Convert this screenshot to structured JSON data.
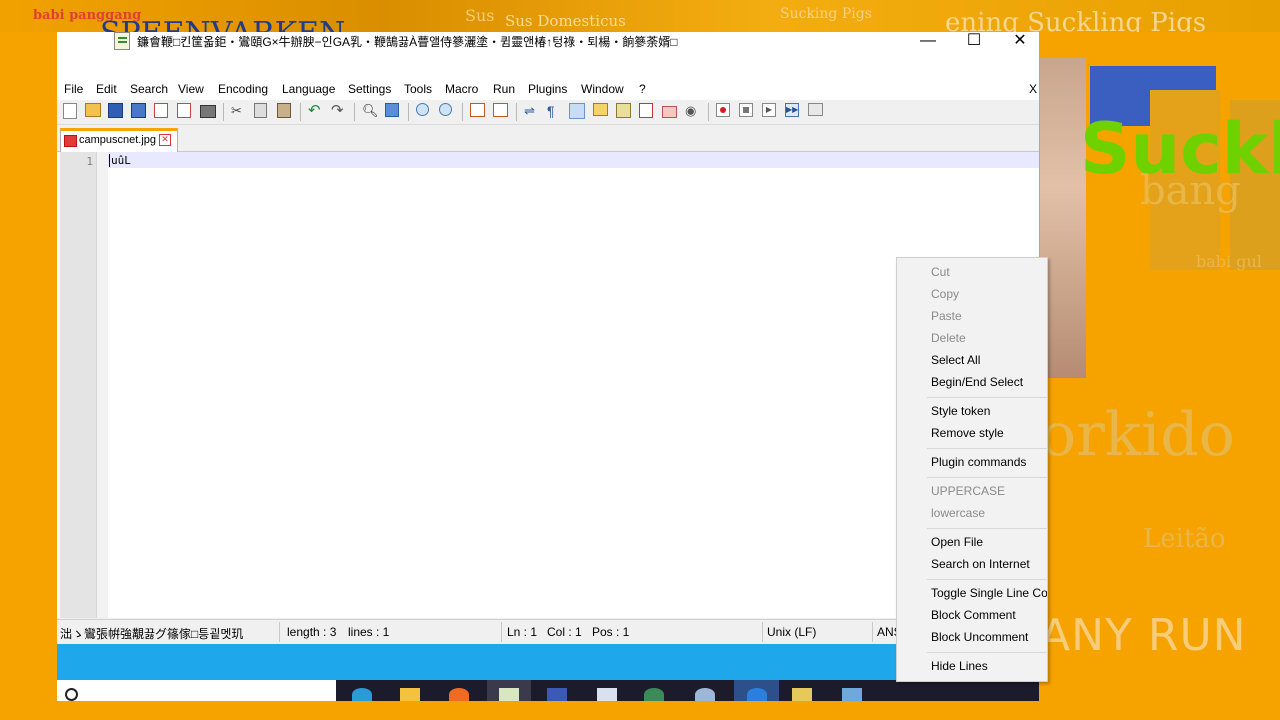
{
  "desktop": {
    "bg_texts": {
      "top_left": "babi panggang",
      "big_blue": "SPEENVARKEN",
      "sus": "Sus",
      "domesticus": "Sus Domesticus",
      "roasting": "Sucking Pigs",
      "top_right": "ening Suckling Pigs"
    },
    "words": {
      "suckl": "Suckl",
      "bang": "bang",
      "babi": "babi gul",
      "orkido": "orkido",
      "leitao": "Leitão"
    },
    "watermark": "ANY RUN"
  },
  "window": {
    "title": "鐮會鞭□킨筐옯鉅‧鸞頤G×牛辦腴−인GA乳‧鞭鵠끓À瞢앨侍篸灑塗‧큄靈앤椿↑텅祿‧퇴楊‧餉篸荼婿□",
    "controls": {
      "minimize": "—",
      "maximize": "☐",
      "close": "✕"
    },
    "menu": [
      "File",
      "Edit",
      "Search",
      "View",
      "Encoding",
      "Language",
      "Settings",
      "Tools",
      "Macro",
      "Run",
      "Plugins",
      "Window",
      "?"
    ],
    "menu_close": "X",
    "toolbar_icons": [
      "new-icon",
      "open-icon",
      "save-icon",
      "save-all-icon",
      "close-icon",
      "close-all-icon",
      "print-icon",
      "cut-icon",
      "copy-icon",
      "paste-icon",
      "undo-icon",
      "redo-icon",
      "find-icon",
      "replace-icon",
      "zoom-in-icon",
      "zoom-out-icon",
      "sync-v-icon",
      "sync-h-icon",
      "wrap-icon",
      "all-chars-icon",
      "indent-guide-icon",
      "udl-icon",
      "doc-map-icon",
      "func-list-icon",
      "folder-workspace-icon",
      "monitor-icon",
      "record-icon",
      "stop-icon",
      "play-icon",
      "play-multi-icon",
      "save-macro-icon"
    ],
    "tab": {
      "label": "campuscnet.jpg"
    },
    "editor": {
      "line_number": "1",
      "content": "uûL"
    },
    "status": {
      "file_type": "泏ゝ鸞張帲強覯끓グ篠傢□틍굍멧玑",
      "length": "length : 3",
      "lines": "lines : 1",
      "ln": "Ln : 1",
      "col": "Col : 1",
      "pos": "Pos : 1",
      "eol": "Unix (LF)",
      "encoding": "ANSI"
    }
  },
  "context_menu": [
    {
      "label": "Cut",
      "enabled": false
    },
    {
      "label": "Copy",
      "enabled": false
    },
    {
      "label": "Paste",
      "enabled": false
    },
    {
      "label": "Delete",
      "enabled": false
    },
    {
      "label": "Select All",
      "enabled": true
    },
    {
      "label": "Begin/End Select",
      "enabled": true
    },
    {
      "label": "Style token",
      "enabled": true
    },
    {
      "label": "Remove style",
      "enabled": true
    },
    {
      "label": "Plugin commands",
      "enabled": true
    },
    {
      "label": "UPPERCASE",
      "enabled": false
    },
    {
      "label": "lowercase",
      "enabled": false
    },
    {
      "label": "Open File",
      "enabled": true
    },
    {
      "label": "Search on Internet",
      "enabled": true
    },
    {
      "label": "Toggle Single Line Comment",
      "enabled": true
    },
    {
      "label": "Block Comment",
      "enabled": true
    },
    {
      "label": "Block Uncomment",
      "enabled": true
    },
    {
      "label": "Hide Lines",
      "enabled": true
    }
  ],
  "taskbar": {
    "search_icon": "search-icon",
    "apps": [
      "edge-icon",
      "explorer-icon",
      "firefox-icon",
      "notepadpp-icon",
      "paint-icon",
      "window-icon",
      "globe-icon",
      "media-icon",
      "bluetooth-icon",
      "folder-zip-icon",
      "network-icon"
    ]
  },
  "colors": {
    "accent": "#f7a400",
    "desktop": "#f6a300",
    "taskbar_blue": "#1ea7ea",
    "current_line": "#e8e8ff"
  }
}
